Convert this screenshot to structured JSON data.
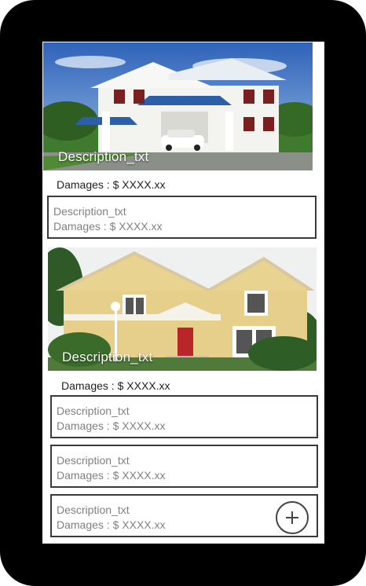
{
  "listings": [
    {
      "image_label": "white-modern-house-photo",
      "caption": "Description_txt",
      "damages": "Damages : $ XXXX.xx"
    },
    {
      "image_label": "yellow-victorian-house-photo",
      "caption": "Description_txt",
      "damages": "Damages : $ XXXX.xx"
    }
  ],
  "cards": [
    {
      "description": "Description_txt",
      "damages": "Damages : $ XXXX.xx"
    },
    {
      "description": "Description_txt",
      "damages": "Damages : $ XXXX.xx"
    },
    {
      "description": "Description_txt",
      "damages": "Damages : $ XXXX.xx"
    },
    {
      "description": "Description_txt",
      "damages": "Damages : $ XXXX.xx"
    }
  ],
  "add_button": {
    "icon": "plus-icon"
  },
  "colors": {
    "frame": "#000000",
    "card_border": "#3a3a3a",
    "secondary_text": "#808080"
  }
}
